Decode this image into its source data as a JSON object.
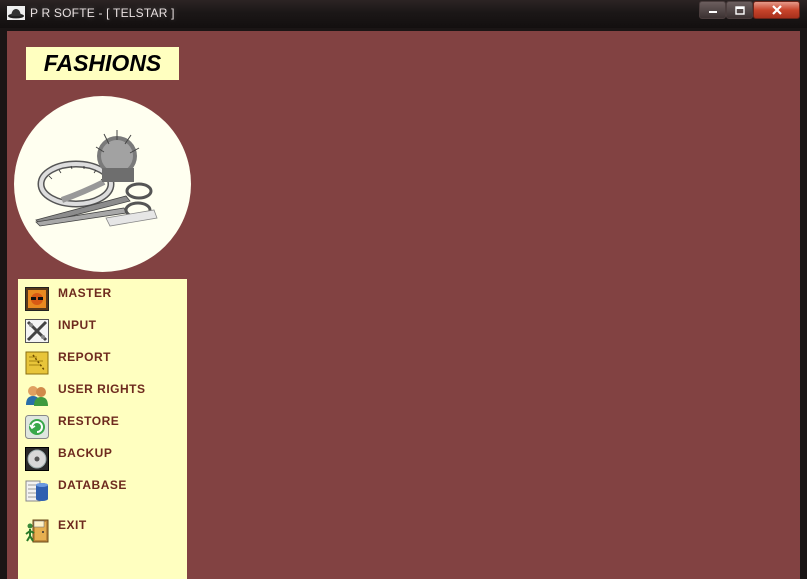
{
  "window": {
    "title": "P R  SOFTE - [ TELSTAR ]",
    "background_color": "#824242",
    "panel_color": "#ffffc0",
    "menu_text_color": "#6e2a1e"
  },
  "brand": {
    "label": "FASHIONS"
  },
  "menu": {
    "items": [
      {
        "label": "MASTER",
        "icon": "master-icon"
      },
      {
        "label": "INPUT",
        "icon": "input-icon"
      },
      {
        "label": "REPORT",
        "icon": "report-icon"
      },
      {
        "label": "USER RIGHTS",
        "icon": "users-icon"
      },
      {
        "label": "RESTORE",
        "icon": "restore-icon"
      },
      {
        "label": "BACKUP",
        "icon": "disc-icon"
      },
      {
        "label": "DATABASE",
        "icon": "database-icon"
      },
      {
        "label": "EXIT",
        "icon": "exit-door-icon"
      }
    ]
  }
}
